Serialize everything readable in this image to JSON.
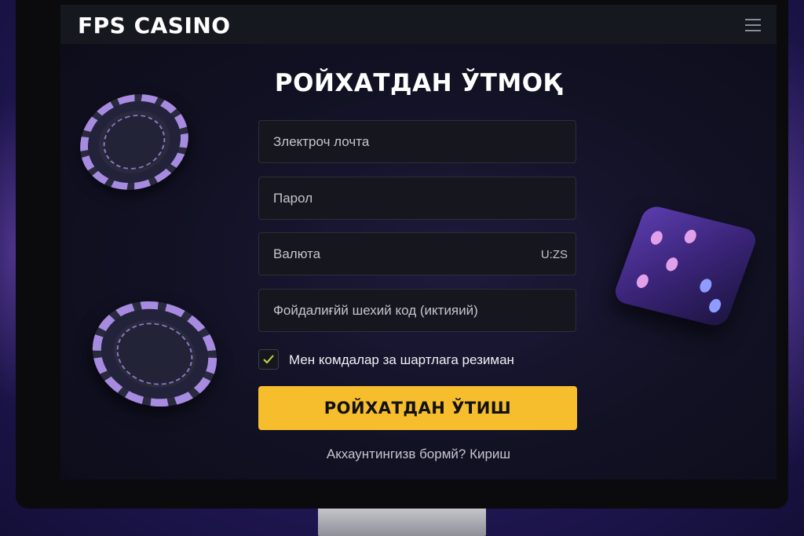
{
  "brand": {
    "logo_text": "FPS CASINO"
  },
  "header": {
    "menu_icon": "hamburger-menu-icon"
  },
  "form": {
    "title": "РОЙХАТДАН ЎТМОҚ",
    "email_placeholder": "Злектроч лочта",
    "password_placeholder": "Парол",
    "currency_placeholder": "Валюта",
    "currency_value": "U:ZS",
    "promo_placeholder": "Фойдалиғйй шехий код (иктияий)",
    "terms_checked": true,
    "terms_label": "Мен комдалар за шартлага резиман",
    "submit_label": "РОЙХАТДАН ЎТИШ",
    "login_prompt": "Акхаунтингизв бормй? Кириш"
  },
  "colors": {
    "accent_button": "#f6bd2d",
    "checkmark": "#c8d84a",
    "chip_stripe": "#a68be0",
    "dice": "#4a2f95"
  }
}
